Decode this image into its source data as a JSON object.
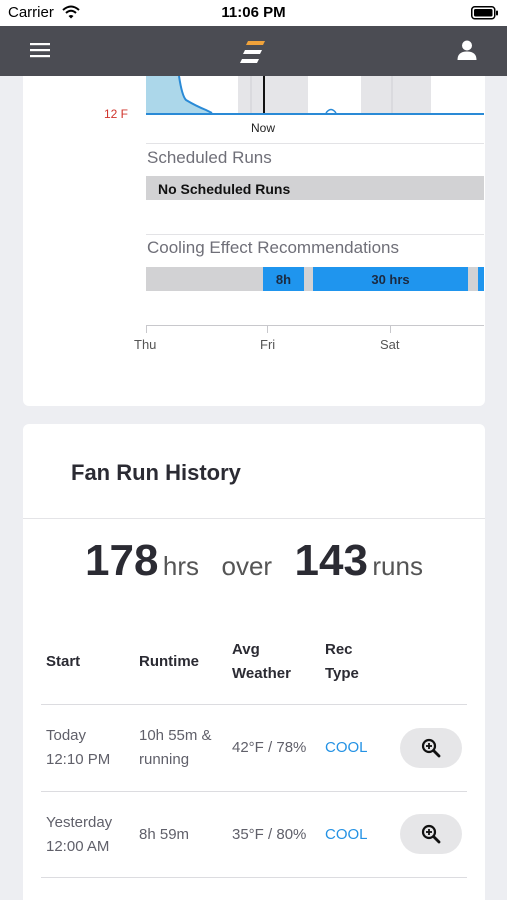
{
  "status_bar": {
    "carrier": "Carrier",
    "time": "11:06 PM"
  },
  "chart": {
    "temperature_label": "12 F",
    "now_label": "Now",
    "scheduled_runs_title": "Scheduled Runs",
    "no_scheduled_runs": "No Scheduled Runs",
    "cooling_title": "Cooling Effect Recommendations",
    "cooling_segments": [
      "8h",
      "30 hrs"
    ],
    "axis_days": [
      "Thu",
      "Fri",
      "Sat"
    ]
  },
  "history": {
    "title": "Fan Run History",
    "summary": {
      "hours": "178",
      "hours_unit": "hrs",
      "over": "over",
      "runs": "143",
      "runs_unit": "runs"
    },
    "columns": {
      "start": "Start",
      "runtime": "Runtime",
      "avg_weather_1": "Avg",
      "avg_weather_2": "Weather",
      "rec_type_1": "Rec",
      "rec_type_2": "Type"
    },
    "rows": [
      {
        "start_1": "Today",
        "start_2": "12:10 PM",
        "runtime_1": "10h 55m &",
        "runtime_2": "running",
        "weather": "42°F / 78%",
        "rec": "COOL"
      },
      {
        "start_1": "Yesterday",
        "start_2": "12:00 AM",
        "runtime_1": "8h 59m",
        "weather": "35°F / 80%",
        "rec": "COOL"
      }
    ]
  },
  "colors": {
    "nav": "#4b4c53",
    "accent_blue": "#1f95ee",
    "cool_text": "#2492e4",
    "temp_red": "#d0342c"
  }
}
